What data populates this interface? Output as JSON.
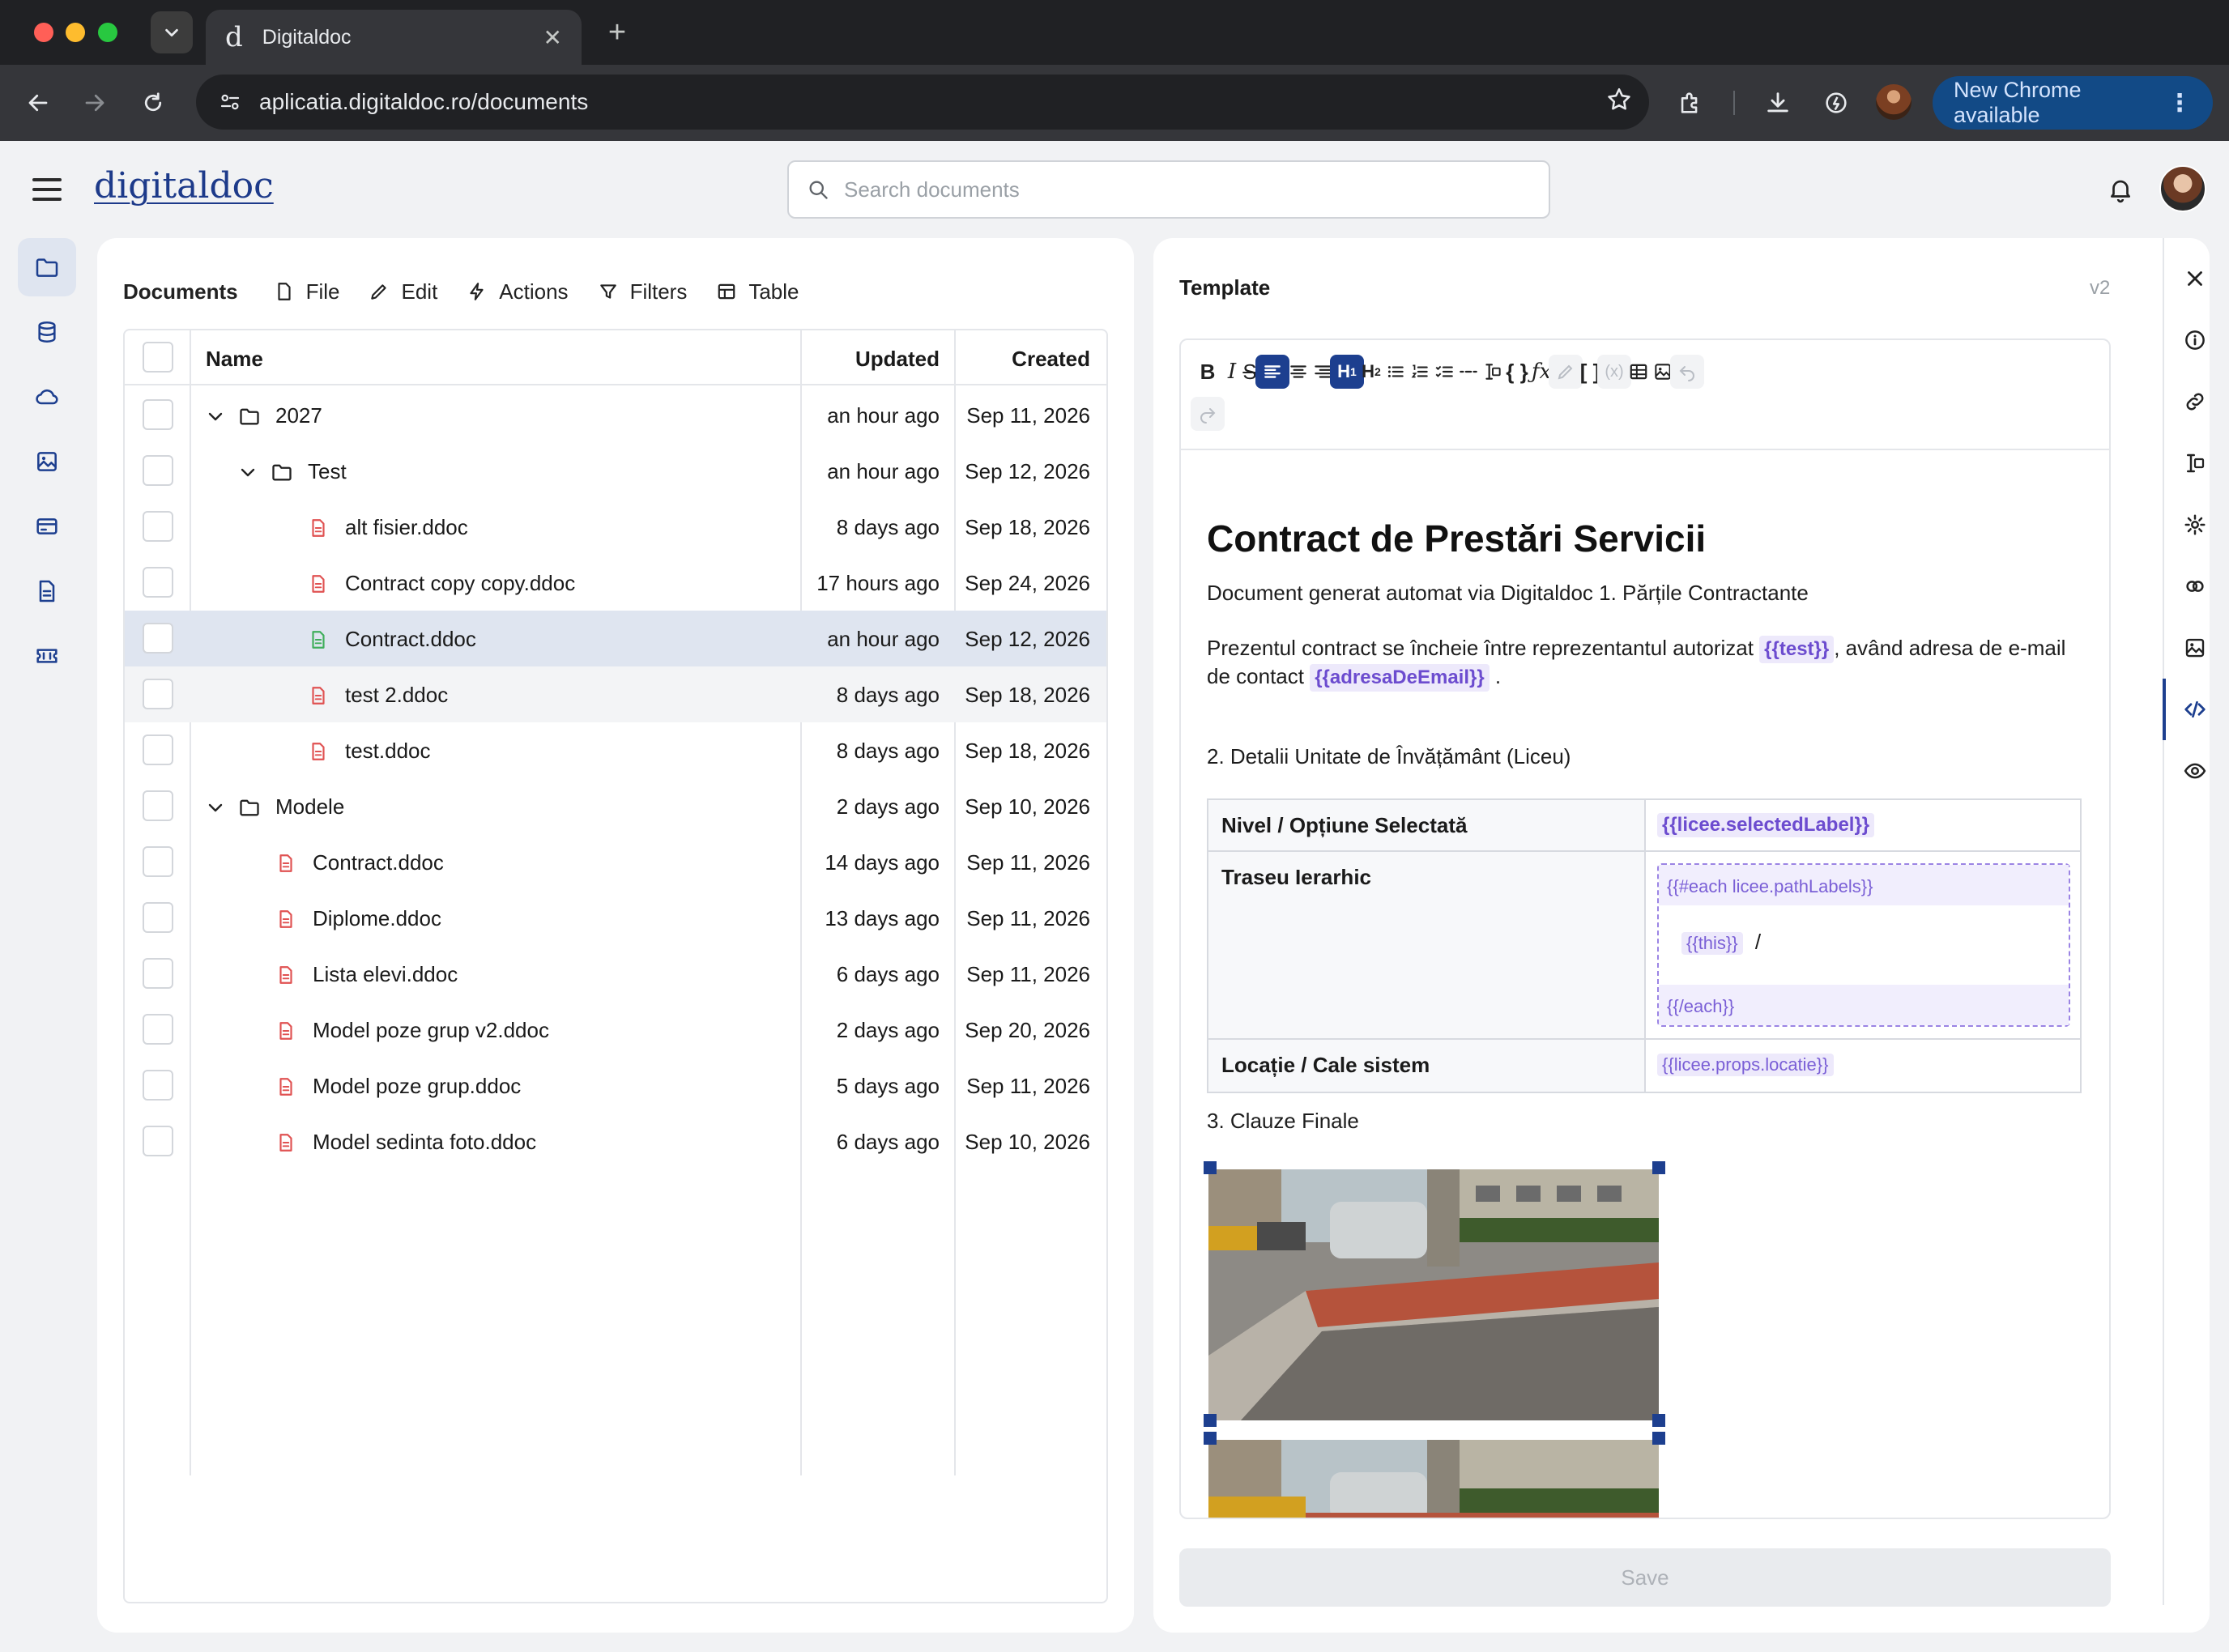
{
  "browser": {
    "tab_title": "Digitaldoc",
    "tab_favicon": "d",
    "url": "aplicatia.digitaldoc.ro/documents",
    "new_chrome_label": "New Chrome available"
  },
  "app": {
    "logo": "digitaldoc",
    "search_placeholder": "Search documents"
  },
  "documents": {
    "title": "Documents",
    "toolbar": {
      "file": "File",
      "edit": "Edit",
      "actions": "Actions",
      "filters": "Filters",
      "table": "Table"
    },
    "columns": {
      "name": "Name",
      "updated": "Updated",
      "created": "Created"
    },
    "rows": [
      {
        "name": "2027",
        "updated": "an hour ago",
        "created": "Sep 11, 2026",
        "type": "folder",
        "depth": 0,
        "expanded": true
      },
      {
        "name": "Test",
        "updated": "an hour ago",
        "created": "Sep 12, 2026",
        "type": "folder",
        "depth": 1,
        "expanded": true
      },
      {
        "name": "alt fisier.ddoc",
        "updated": "8 days ago",
        "created": "Sep 18, 2026",
        "type": "file",
        "depth": 2
      },
      {
        "name": "Contract copy copy.ddoc",
        "updated": "17 hours ago",
        "created": "Sep 24, 2026",
        "type": "file",
        "depth": 2
      },
      {
        "name": "Contract.ddoc",
        "updated": "an hour ago",
        "created": "Sep 12, 2026",
        "type": "file-active",
        "depth": 2,
        "selected": true
      },
      {
        "name": "test 2.ddoc",
        "updated": "8 days ago",
        "created": "Sep 18, 2026",
        "type": "file",
        "depth": 2,
        "hover": true
      },
      {
        "name": "test.ddoc",
        "updated": "8 days ago",
        "created": "Sep 18, 2026",
        "type": "file",
        "depth": 2
      },
      {
        "name": "Modele",
        "updated": "2 days ago",
        "created": "Sep 10, 2026",
        "type": "folder",
        "depth": 0,
        "expanded": true
      },
      {
        "name": "Contract.ddoc",
        "updated": "14 days ago",
        "created": "Sep 11, 2026",
        "type": "file",
        "depth": 1
      },
      {
        "name": "Diplome.ddoc",
        "updated": "13 days ago",
        "created": "Sep 11, 2026",
        "type": "file",
        "depth": 1
      },
      {
        "name": "Lista elevi.ddoc",
        "updated": "6 days ago",
        "created": "Sep 11, 2026",
        "type": "file",
        "depth": 1
      },
      {
        "name": "Model poze grup v2.ddoc",
        "updated": "2 days ago",
        "created": "Sep 20, 2026",
        "type": "file",
        "depth": 1
      },
      {
        "name": "Model poze grup.ddoc",
        "updated": "5 days ago",
        "created": "Sep 11, 2026",
        "type": "file",
        "depth": 1
      },
      {
        "name": "Model sedinta foto.ddoc",
        "updated": "6 days ago",
        "created": "Sep 10, 2026",
        "type": "file",
        "depth": 1
      }
    ]
  },
  "template": {
    "title": "Template",
    "version": "v2",
    "heading": "Contract de Prestări Servicii",
    "intro": "Document generat automat via Digitaldoc 1. Părțile Contractante",
    "para_a": "Prezentul contract se încheie între reprezentantul autorizat",
    "tag_test": "{{test}}",
    "para_b": ", având adresa de e-mail",
    "para_c": "de contact",
    "tag_email": "{{adresaDeEmail}}",
    "para_d": ".",
    "section2": "2. Detalii Unitate de Învățământ (Liceu)",
    "table": {
      "r1_label": "Nivel / Opțiune Selectată",
      "r1_value": "{{licee.selectedLabel}}",
      "r2_label": "Traseu Ierarhic",
      "each_open": "{{#each licee.pathLabels}}",
      "each_this": "{{this}}",
      "each_sep": "/",
      "each_close": "{{/each}}",
      "r3_label": "Locație / Cale sistem",
      "r3_value": "{{licee.props.locatie}}"
    },
    "section3": "3. Clauze Finale",
    "save_label": "Save"
  },
  "colors": {
    "accent": "#1d3f8f",
    "selected_row": "#dfe5f0",
    "file_icon": "#e05252",
    "file_icon_active": "#3fae5b",
    "tag_bg": "#ede9fb",
    "tag_text": "#6c4ccf"
  }
}
